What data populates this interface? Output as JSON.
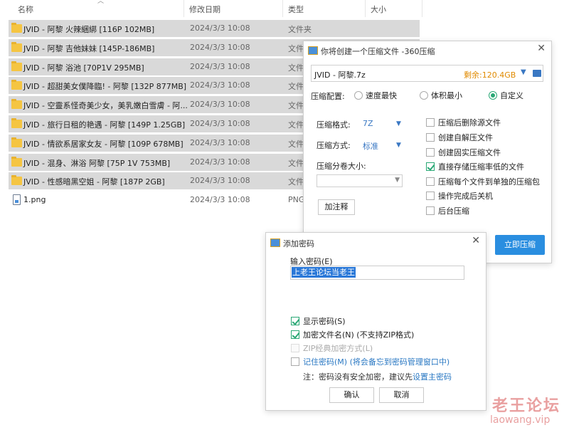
{
  "explorer": {
    "columns": {
      "name": "名称",
      "date": "修改日期",
      "type": "类型",
      "size": "大小"
    },
    "files": [
      {
        "name": "JVID - 阿黎 火辣綑綁 [116P 102MB]",
        "date": "2024/3/3 10:08",
        "type": "文件夹",
        "icon": "folder-icon",
        "selected": true
      },
      {
        "name": "JVID - 阿黎 吉他妹妹 [145P-186MB]",
        "date": "2024/3/3 10:08",
        "type": "文件",
        "icon": "folder-icon",
        "selected": true
      },
      {
        "name": "JVID - 阿黎 浴池 [70P1V 295MB]",
        "date": "2024/3/3 10:08",
        "type": "文件",
        "icon": "folder-icon",
        "selected": true
      },
      {
        "name": "JVID - 超甜美女僕降臨! - 阿黎 [132P 877MB]",
        "date": "2024/3/3 10:08",
        "type": "文件",
        "icon": "folder-icon",
        "selected": true
      },
      {
        "name": "JVID - 空靈系怪奇美少女，美乳嫩白雪膚 - 阿...",
        "date": "2024/3/3 10:08",
        "type": "文件",
        "icon": "folder-icon",
        "selected": true
      },
      {
        "name": "JVID - 旅行日租的艳遇 - 阿黎 [149P 1.25GB]",
        "date": "2024/3/3 10:08",
        "type": "文件",
        "icon": "folder-icon",
        "selected": true
      },
      {
        "name": "JVID - 情欲系居家女友 - 阿黎 [109P 678MB]",
        "date": "2024/3/3 10:08",
        "type": "文件",
        "icon": "folder-icon",
        "selected": true
      },
      {
        "name": "JVID - 混身、淋浴 阿黎 [75P 1V 753MB]",
        "date": "2024/3/3 10:08",
        "type": "文件",
        "icon": "folder-icon",
        "selected": true
      },
      {
        "name": "JVID - 性感暗黑空姐 - 阿黎 [187P 2GB]",
        "date": "2024/3/3 10:08",
        "type": "文件",
        "icon": "folder-icon",
        "selected": true
      },
      {
        "name": "1.png",
        "date": "2024/3/3 10:08",
        "type": "PNG",
        "icon": "png-file-icon",
        "selected": false
      }
    ]
  },
  "zip_dialog": {
    "title": "你将创建一个压缩文件 -360压缩",
    "filename": "JVID - 阿黎.7z",
    "free_space": "剩余:120.4GB",
    "config_label": "压缩配置:",
    "presets": [
      {
        "label": "速度最快",
        "checked": false
      },
      {
        "label": "体积最小",
        "checked": false
      },
      {
        "label": "自定义",
        "checked": true
      }
    ],
    "format_label": "压缩格式:",
    "format_value": "7Z",
    "method_label": "压缩方式:",
    "method_value": "标准",
    "volume_label": "压缩分卷大小:",
    "comment_button": "加注释",
    "options": [
      {
        "label": "压缩后删除源文件",
        "checked": false
      },
      {
        "label": "创建自解压文件",
        "checked": false
      },
      {
        "label": "创建固实压缩文件",
        "checked": false
      },
      {
        "label": "直接存储压缩率低的文件",
        "checked": true
      },
      {
        "label": "压缩每个文件到单独的压缩包",
        "checked": false
      },
      {
        "label": "操作完成后关机",
        "checked": false
      },
      {
        "label": "后台压缩",
        "checked": false
      }
    ],
    "compress_button": "立即压缩"
  },
  "password_dialog": {
    "title": "添加密码",
    "input_label": "输入密码(E)",
    "password_value": "上老王论坛当老王",
    "show_password": {
      "label": "显示密码(S)",
      "checked": true
    },
    "encrypt_names": {
      "label": "加密文件名(N) (不支持ZIP格式)",
      "checked": true
    },
    "zip_classic": {
      "label": "ZIP经典加密方式(L)",
      "checked": false,
      "disabled": true
    },
    "remember": {
      "label": "记住密码(M) (将会备忘到密码管理窗口中)",
      "checked": false
    },
    "note_prefix": "注：密码没有安全加密，建议先",
    "note_link": "设置主密码",
    "ok_button": "确认",
    "cancel_button": "取消"
  },
  "watermark": {
    "cn": "老王论坛",
    "url": "laowang.vip"
  }
}
